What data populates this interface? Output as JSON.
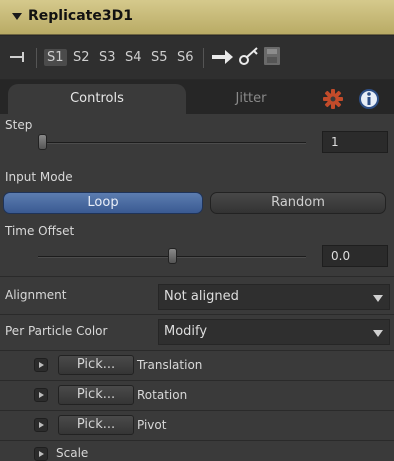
{
  "header": {
    "title": "Replicate3D1"
  },
  "toolbar": {
    "slots": [
      "S1",
      "S2",
      "S3",
      "S4",
      "S5",
      "S6"
    ],
    "active_slot": "S1"
  },
  "tabs": {
    "controls": "Controls",
    "jitter": "Jitter",
    "settings_icon": "gear-icon",
    "info_icon": "info-icon"
  },
  "controls": {
    "step": {
      "label": "Step",
      "value": "1",
      "level": 0.0
    },
    "input_mode": {
      "label": "Input Mode",
      "options": [
        "Loop",
        "Random"
      ],
      "selected": "Loop"
    },
    "time_offset": {
      "label": "Time Offset",
      "value": "0.0",
      "level": 0.5
    },
    "alignment": {
      "label": "Alignment",
      "value": "Not aligned"
    },
    "per_particle_color": {
      "label": "Per Particle Color",
      "value": "Modify"
    },
    "pick_rows": [
      {
        "button": "Pick...",
        "label": "Translation"
      },
      {
        "button": "Pick...",
        "label": "Rotation"
      },
      {
        "button": "Pick...",
        "label": "Pivot"
      }
    ],
    "scale": {
      "label": "Scale"
    }
  },
  "colors": {
    "title_bar": "#c9bc78",
    "accent_button": "#4a6aa2",
    "panel": "#3a3a3a"
  }
}
